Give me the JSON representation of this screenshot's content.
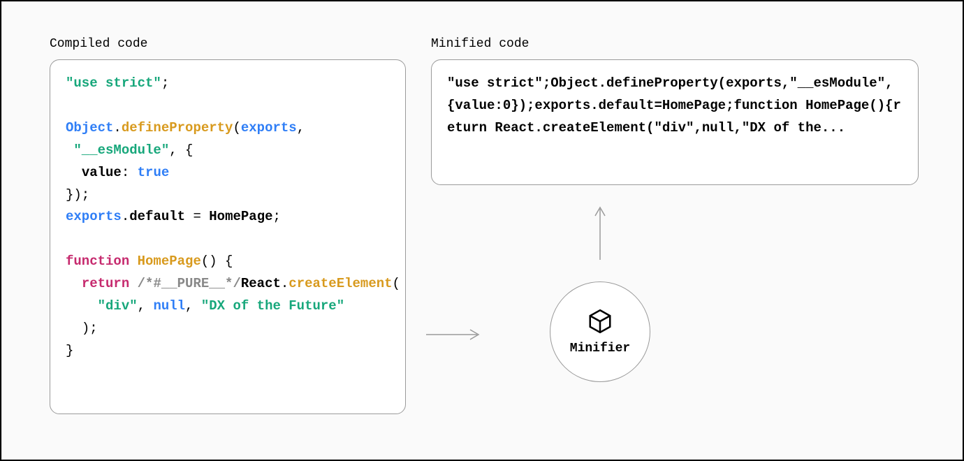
{
  "labels": {
    "compiled": "Compiled code",
    "minified": "Minified code",
    "minifier": "Minifier"
  },
  "compiled_code": {
    "tokens": [
      {
        "t": "\"use strict\"",
        "c": "tk-str"
      },
      {
        "t": ";",
        "c": "tk-plain"
      },
      {
        "t": "\n\n",
        "c": "tk-plain"
      },
      {
        "t": "Object",
        "c": "tk-obj"
      },
      {
        "t": ".",
        "c": "tk-plain"
      },
      {
        "t": "defineProperty",
        "c": "tk-fn"
      },
      {
        "t": "(",
        "c": "tk-plain"
      },
      {
        "t": "exports",
        "c": "tk-obj"
      },
      {
        "t": ",",
        "c": "tk-plain"
      },
      {
        "t": "\n ",
        "c": "tk-plain"
      },
      {
        "t": "\"__esModule\"",
        "c": "tk-str"
      },
      {
        "t": ", {",
        "c": "tk-plain"
      },
      {
        "t": "\n  ",
        "c": "tk-plain"
      },
      {
        "t": "value",
        "c": "tk-id"
      },
      {
        "t": ": ",
        "c": "tk-plain"
      },
      {
        "t": "true",
        "c": "tk-bool"
      },
      {
        "t": "\n",
        "c": "tk-plain"
      },
      {
        "t": "});",
        "c": "tk-plain"
      },
      {
        "t": "\n",
        "c": "tk-plain"
      },
      {
        "t": "exports",
        "c": "tk-obj"
      },
      {
        "t": ".",
        "c": "tk-plain"
      },
      {
        "t": "default",
        "c": "tk-id"
      },
      {
        "t": " = ",
        "c": "tk-plain"
      },
      {
        "t": "HomePage",
        "c": "tk-id"
      },
      {
        "t": ";",
        "c": "tk-plain"
      },
      {
        "t": "\n\n",
        "c": "tk-plain"
      },
      {
        "t": "function",
        "c": "tk-kw"
      },
      {
        "t": " ",
        "c": "tk-plain"
      },
      {
        "t": "HomePage",
        "c": "tk-fn"
      },
      {
        "t": "() {",
        "c": "tk-plain"
      },
      {
        "t": "\n  ",
        "c": "tk-plain"
      },
      {
        "t": "return",
        "c": "tk-kw"
      },
      {
        "t": " ",
        "c": "tk-plain"
      },
      {
        "t": "/*#__PURE__*/",
        "c": "tk-cmt"
      },
      {
        "t": "React",
        "c": "tk-id"
      },
      {
        "t": ".",
        "c": "tk-plain"
      },
      {
        "t": "createElement",
        "c": "tk-fn"
      },
      {
        "t": "(",
        "c": "tk-plain"
      },
      {
        "t": "\n    ",
        "c": "tk-plain"
      },
      {
        "t": "\"div\"",
        "c": "tk-str"
      },
      {
        "t": ", ",
        "c": "tk-plain"
      },
      {
        "t": "null",
        "c": "tk-bool"
      },
      {
        "t": ", ",
        "c": "tk-plain"
      },
      {
        "t": "\"DX of the Future\"",
        "c": "tk-str"
      },
      {
        "t": "\n  ",
        "c": "tk-plain"
      },
      {
        "t": ");",
        "c": "tk-plain"
      },
      {
        "t": "\n",
        "c": "tk-plain"
      },
      {
        "t": "}",
        "c": "tk-plain"
      }
    ]
  },
  "minified_code": "\"use strict\";Object.defineProperty(exports,\"__esModule\",{value:0});exports.default=HomePage;function HomePage(){return React.createElement(\"div\",null,\"DX of the...",
  "icons": {
    "cube": "cube-icon",
    "arrow_right": "arrow-right-icon",
    "arrow_up": "arrow-up-icon"
  }
}
